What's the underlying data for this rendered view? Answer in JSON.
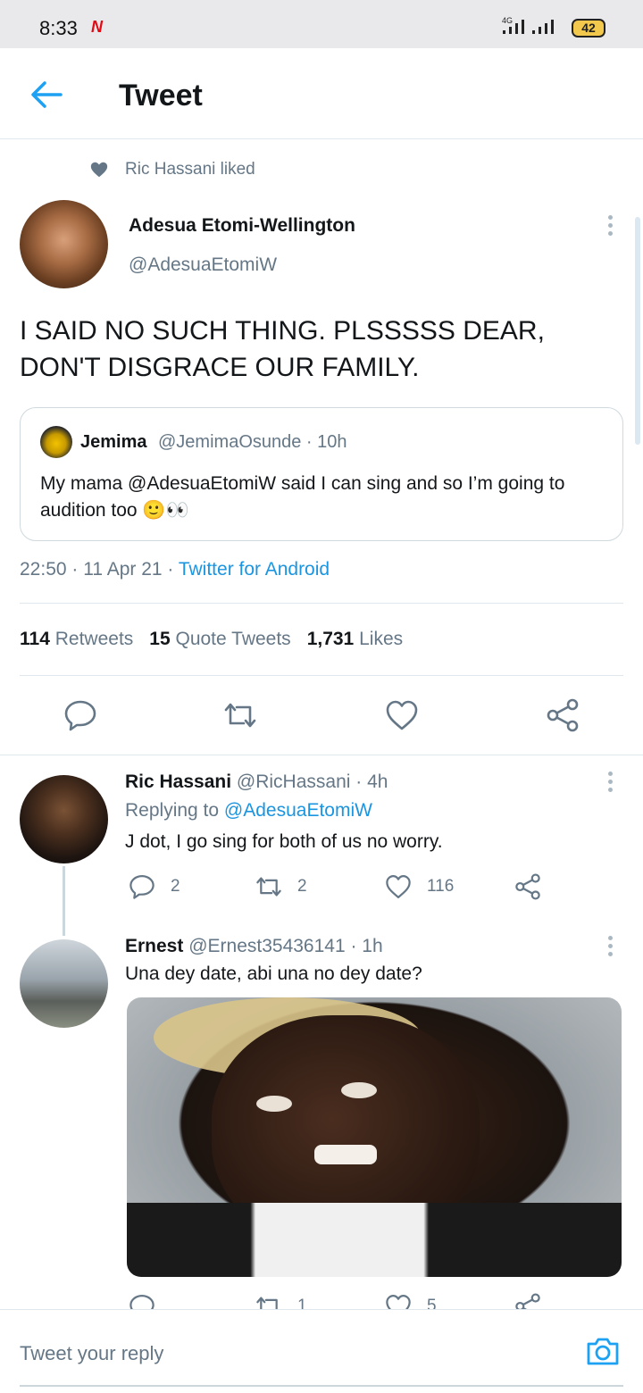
{
  "status_bar": {
    "time": "8:33",
    "netflix_badge": "N",
    "network": "4G",
    "battery": "42"
  },
  "header": {
    "title": "Tweet"
  },
  "social_context": {
    "text": "Ric Hassani liked"
  },
  "tweet": {
    "author_name": "Adesua Etomi-Wellington",
    "author_handle": "@AdesuaEtomiW",
    "text": "I SAID NO SUCH THING. PLSSSSS DEAR, DON'T DISGRACE OUR FAMILY.",
    "quote": {
      "name": "Jemima",
      "handle_time": "@JemimaOsunde · 10h",
      "text": "My mama @AdesuaEtomiW said I can sing and so I’m going to audition too 🙂👀"
    },
    "meta": {
      "timestamp": "22:50 · 11 Apr 21 · ",
      "source": "Twitter for Android"
    },
    "stats": {
      "retweets_count": "114",
      "retweets_label": "Retweets",
      "quotes_count": "15",
      "quotes_label": "Quote Tweets",
      "likes_count": "1,731",
      "likes_label": "Likes"
    }
  },
  "replies": [
    {
      "name": "Ric Hassani",
      "handle_time": "@RicHassani · 4h",
      "replying_prefix": "Replying to ",
      "replying_to": "@AdesuaEtomiW",
      "text": "J dot, I go sing for both of us no worry.",
      "reply_count": "2",
      "retweet_count": "2",
      "like_count": "116"
    },
    {
      "name": "Ernest",
      "handle_time": "@Ernest35436141 · 1h",
      "text": "Una dey date, abi una no dey date?",
      "retweet_count": "1",
      "like_count": "5"
    }
  ],
  "composer": {
    "placeholder": "Tweet your reply"
  },
  "colors": {
    "accent": "#1da1f2",
    "link": "#1b95e0",
    "secondary_text": "#657786",
    "divider": "#e1e8ed"
  },
  "icons": [
    "back-arrow-icon",
    "heart-icon",
    "more-icon",
    "reply-icon",
    "retweet-icon",
    "like-icon",
    "share-icon",
    "camera-icon"
  ]
}
